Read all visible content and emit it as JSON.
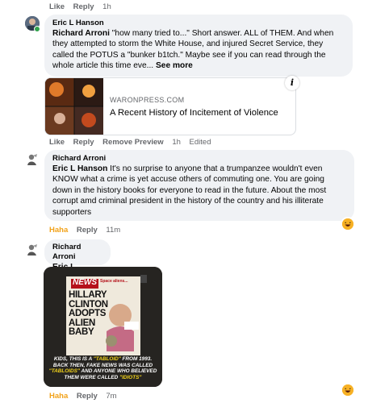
{
  "top_actions": {
    "like": "Like",
    "reply": "Reply",
    "time": "1h"
  },
  "comment1": {
    "author": "Eric L Hanson",
    "mention": "Richard Arroni",
    "text": " \"how many tried to...\" Short answer. ALL of THEM. And when they attempted to storm the White House, and injured Secret Service, they called the POTUS a \"bunker b1tch.\" Maybe see if you can read through the whole article this time eve...",
    "see_more": "See more",
    "link": {
      "domain": "WARONPRESS.COM",
      "title": "A Recent History of Incitement of Violence"
    },
    "actions": {
      "like": "Like",
      "reply": "Reply",
      "remove_preview": "Remove Preview",
      "time": "1h",
      "edited": "Edited"
    }
  },
  "comment2": {
    "author": "Richard Arroni",
    "mention": "Eric L Hanson",
    "text": " It's no surprise to anyone that a trumpanzee wouldn't even KNOW what a crime is yet accuse others of commuting one. You are going down in the history books for everyone to read in the future. About the most corrupt amd criminal president in the history of the country and his illiterate supporters",
    "actions": {
      "reaction": "Haha",
      "reply": "Reply",
      "time": "11m"
    }
  },
  "comment3": {
    "author": "Richard Arroni",
    "mention": "Eric L Hanson",
    "image": {
      "masthead": "NEWS",
      "blurb": "Space aliens...",
      "headline": [
        "HILLARY",
        "CLINTON",
        "ADOPTS",
        "ALIEN",
        "BABY"
      ],
      "caption_pre": "KIDS, THIS IS A ",
      "caption_hl1": "\"TABLOID\"",
      "caption_mid1": " FROM 1993. BACK THEN, FAKE NEWS WAS CALLED ",
      "caption_hl2": "\"TABLOIDS\"",
      "caption_mid2": " AND ANYONE WHO BELIEVED THEM WERE CALLED ",
      "caption_hl3": "\"IDIOTS\""
    },
    "actions": {
      "reaction": "Haha",
      "reply": "Reply",
      "time": "7m"
    }
  },
  "colors": {
    "bubble": "#f0f2f5",
    "muted": "#65676b",
    "haha": "#f2a219",
    "online": "#31a24c"
  }
}
